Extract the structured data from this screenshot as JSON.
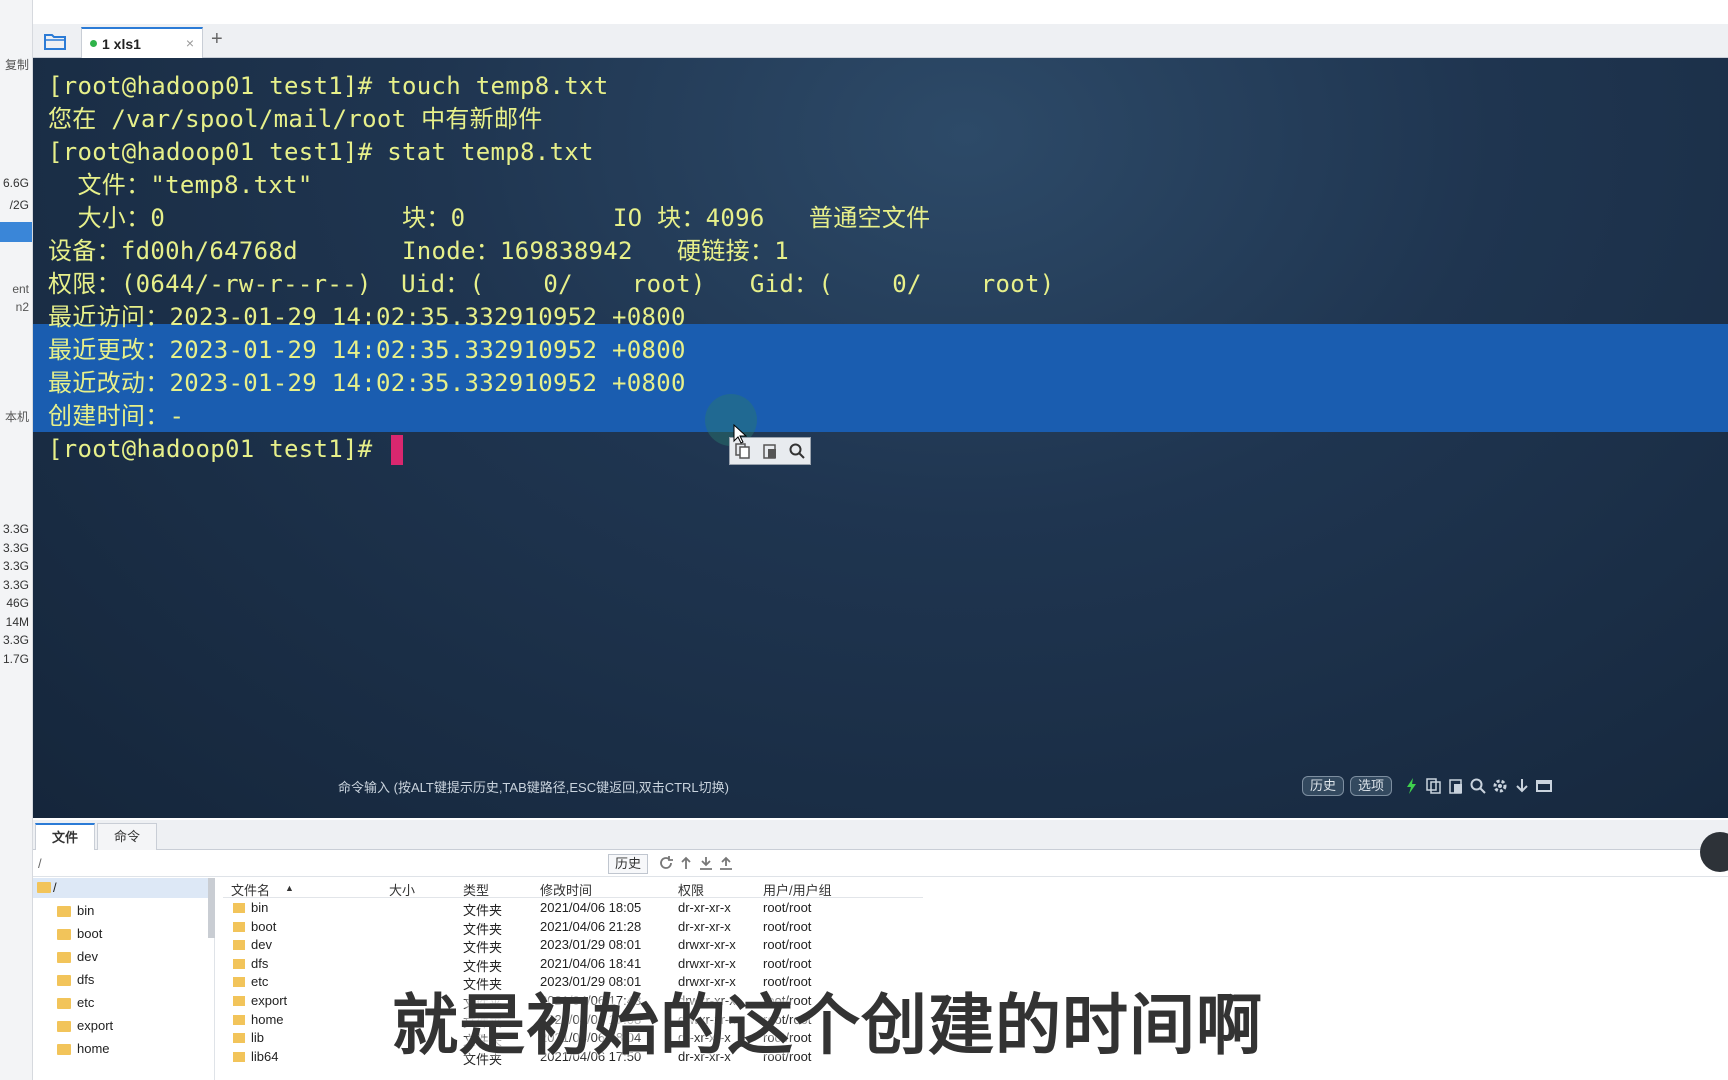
{
  "left_panel": {
    "items": [
      "复制",
      "6.6G",
      "/2G",
      "ent",
      "n2",
      "本机",
      "3.3G",
      "3.3G",
      "3.3G",
      "3.3G",
      "46G",
      "14M",
      "3.3G",
      "1.7G"
    ]
  },
  "tabs": {
    "active_tab": "1 xls1"
  },
  "terminal": {
    "lines": [
      "[root@hadoop01 test1]# touch temp8.txt",
      "您在 /var/spool/mail/root 中有新邮件",
      "[root@hadoop01 test1]# stat temp8.txt",
      "  文件：\"temp8.txt\"",
      "  大小：0          \t块：0          IO 块：4096   普通空文件",
      "设备：fd00h/64768d\tInode：169838942   硬链接：1",
      "权限：(0644/-rw-r--r--)  Uid：(    0/    root)   Gid：(    0/    root)",
      "最近访问：2023-01-29 14:02:35.332910952 +0800",
      "最近更改：2023-01-29 14:02:35.332910952 +0800",
      "最近改动：2023-01-29 14:02:35.332910952 +0800",
      "创建时间：-",
      "[root@hadoop01 test1]# "
    ],
    "cmd_hint": "命令输入 (按ALT键提示历史,TAB键路径,ESC键返回,双击CTRL切换)",
    "history_button": "历史",
    "options_button": "选项"
  },
  "bottom": {
    "tab_files": "文件",
    "tab_commands": "命令",
    "path": "/",
    "history_button": "历史",
    "tree_root": "/",
    "tree": [
      "bin",
      "boot",
      "dev",
      "dfs",
      "etc",
      "export",
      "home"
    ],
    "columns": [
      "文件名",
      "大小",
      "类型",
      "修改时间",
      "权限",
      "用户/用户组"
    ],
    "rows": [
      {
        "name": "bin",
        "type": "文件夹",
        "mtime": "2021/04/06 18:05",
        "perm": "dr-xr-xr-x",
        "owner": "root/root"
      },
      {
        "name": "boot",
        "type": "文件夹",
        "mtime": "2021/04/06 21:28",
        "perm": "dr-xr-xr-x",
        "owner": "root/root"
      },
      {
        "name": "dev",
        "type": "文件夹",
        "mtime": "2023/01/29 08:01",
        "perm": "drwxr-xr-x",
        "owner": "root/root"
      },
      {
        "name": "dfs",
        "type": "文件夹",
        "mtime": "2021/04/06 18:41",
        "perm": "drwxr-xr-x",
        "owner": "root/root"
      },
      {
        "name": "etc",
        "type": "文件夹",
        "mtime": "2023/01/29 08:01",
        "perm": "drwxr-xr-x",
        "owner": "root/root"
      },
      {
        "name": "export",
        "type": "文件夹",
        "mtime": "2021/04/06 17:43",
        "perm": "drwxr-xr-x",
        "owner": "root/root"
      },
      {
        "name": "home",
        "type": "文件夹",
        "mtime": "2021/04/06 17:08",
        "perm": "drwxr-xr-x",
        "owner": "root/root"
      },
      {
        "name": "lib",
        "type": "文件夹",
        "mtime": "2021/04/06 18:04",
        "perm": "dr-xr-xr-x",
        "owner": "root/root"
      },
      {
        "name": "lib64",
        "type": "文件夹",
        "mtime": "2021/04/06 17:50",
        "perm": "dr-xr-xr-x",
        "owner": "root/root"
      }
    ]
  },
  "subtitle": "就是初始的这个创建的时间啊",
  "colors": {
    "terminal_text": "#e7f08a",
    "selection": "#1a5db0",
    "cursor": "#d9276f",
    "accent": "#2b7bd6"
  }
}
